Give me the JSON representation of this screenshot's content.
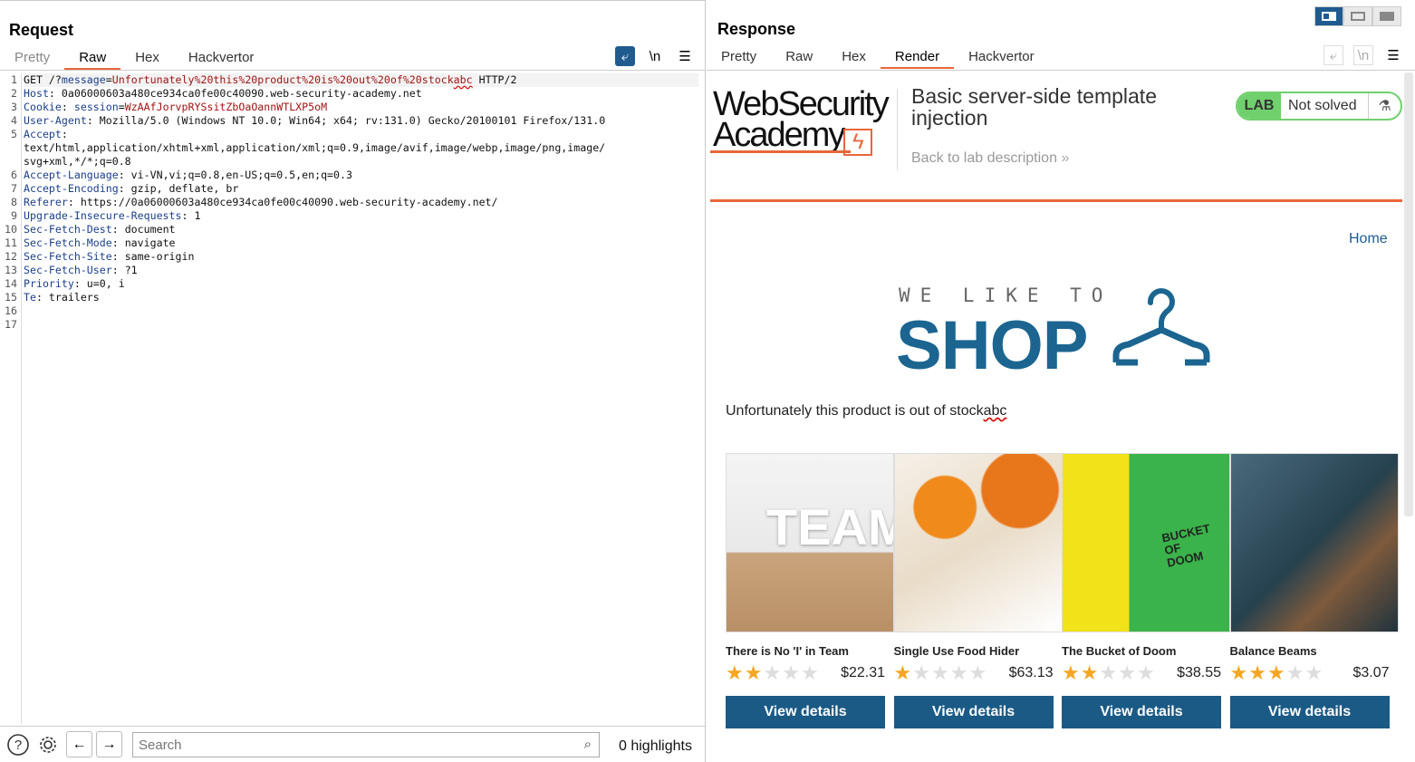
{
  "request": {
    "title": "Request",
    "tabs": [
      "Pretty",
      "Raw",
      "Hex",
      "Hackvertor"
    ],
    "toolbar": {
      "newline_label": "\\n"
    },
    "lines": [
      {
        "n": "1",
        "parts": [
          {
            "t": "GET /?"
          },
          {
            "t": "message",
            "c": "k"
          },
          {
            "t": "="
          },
          {
            "t": "Unfortunately%20this%20product%20is%20out%20of%20stock",
            "c": "v"
          },
          {
            "t": "abc",
            "c": "v sq"
          },
          {
            "t": " HTTP/2"
          }
        ],
        "hl": true
      },
      {
        "n": "2",
        "parts": [
          {
            "t": "Host",
            "c": "k"
          },
          {
            "t": ": 0a06000603a480ce934ca0fe00c40090.web-security-academy.net"
          }
        ]
      },
      {
        "n": "3",
        "parts": [
          {
            "t": "Cookie",
            "c": "k"
          },
          {
            "t": ": "
          },
          {
            "t": "session",
            "c": "k"
          },
          {
            "t": "="
          },
          {
            "t": "WzAAfJorvpRYSsitZbOaOannWTLXP5oM",
            "c": "v"
          }
        ]
      },
      {
        "n": "4",
        "parts": [
          {
            "t": "User-Agent",
            "c": "k"
          },
          {
            "t": ": Mozilla/5.0 (Windows NT 10.0; Win64; x64; rv:131.0) Gecko/20100101 Firefox/131.0"
          }
        ]
      },
      {
        "n": "5",
        "parts": [
          {
            "t": "Accept",
            "c": "k"
          },
          {
            "t": ":"
          }
        ]
      },
      {
        "n": "",
        "parts": [
          {
            "t": "text/html,application/xhtml+xml,application/xml;q=0.9,image/avif,image/webp,image/png,image/"
          }
        ]
      },
      {
        "n": "",
        "parts": [
          {
            "t": "svg+xml,*/*;q=0.8"
          }
        ]
      },
      {
        "n": "6",
        "parts": [
          {
            "t": "Accept-Language",
            "c": "k"
          },
          {
            "t": ": vi-VN,vi;q=0.8,en-US;q=0.5,en;q=0.3"
          }
        ]
      },
      {
        "n": "7",
        "parts": [
          {
            "t": "Accept-Encoding",
            "c": "k"
          },
          {
            "t": ": gzip, deflate, br"
          }
        ]
      },
      {
        "n": "8",
        "parts": [
          {
            "t": "Referer",
            "c": "k"
          },
          {
            "t": ": https://0a06000603a480ce934ca0fe00c40090.web-security-academy.net/"
          }
        ]
      },
      {
        "n": "9",
        "parts": [
          {
            "t": "Upgrade-Insecure-Requests",
            "c": "k"
          },
          {
            "t": ": 1"
          }
        ]
      },
      {
        "n": "10",
        "parts": [
          {
            "t": "Sec-Fetch-Dest",
            "c": "k"
          },
          {
            "t": ": document"
          }
        ]
      },
      {
        "n": "11",
        "parts": [
          {
            "t": "Sec-Fetch-Mode",
            "c": "k"
          },
          {
            "t": ": navigate"
          }
        ]
      },
      {
        "n": "12",
        "parts": [
          {
            "t": "Sec-Fetch-Site",
            "c": "k"
          },
          {
            "t": ": same-origin"
          }
        ]
      },
      {
        "n": "13",
        "parts": [
          {
            "t": "Sec-Fetch-User",
            "c": "k"
          },
          {
            "t": ": ?1"
          }
        ]
      },
      {
        "n": "14",
        "parts": [
          {
            "t": "Priority",
            "c": "k"
          },
          {
            "t": ": u=0, i"
          }
        ]
      },
      {
        "n": "15",
        "parts": [
          {
            "t": "Te",
            "c": "k"
          },
          {
            "t": ": trailers"
          }
        ]
      },
      {
        "n": "16",
        "parts": []
      },
      {
        "n": "17",
        "parts": []
      }
    ],
    "search": {
      "placeholder": "Search",
      "highlights": "0 highlights"
    }
  },
  "response": {
    "title": "Response",
    "tabs": [
      "Pretty",
      "Raw",
      "Hex",
      "Render",
      "Hackvertor"
    ],
    "render": {
      "logo_line1": "WebSecurity",
      "logo_line2": "Academy",
      "lab_title": "Basic server-side template injection",
      "back_link": "Back to lab description",
      "lab_label": "LAB",
      "lab_status": "Not solved",
      "home_link": "Home",
      "shop_tagline": "WE LIKE TO",
      "shop_name": "SHOP",
      "message_text": "Unfortunately this product is out of stock",
      "message_suffix": "abc",
      "products": [
        {
          "name": "There is No 'I' in Team",
          "price": "$22.31",
          "rating": 2,
          "button": "View details",
          "img_text": "TEAM"
        },
        {
          "name": "Single Use Food Hider",
          "price": "$63.13",
          "rating": 1,
          "button": "View details",
          "img_text": ""
        },
        {
          "name": "The Bucket of Doom",
          "price": "$38.55",
          "rating": 2,
          "button": "View details",
          "img_text": "BUCKET OF DOOM"
        },
        {
          "name": "Balance Beams",
          "price": "$3.07",
          "rating": 3,
          "button": "View details",
          "img_text": ""
        }
      ]
    }
  },
  "colors": {
    "accent_orange": "#e8673a",
    "brand_blue": "#1b5a85",
    "lab_green": "#70d06d",
    "star": "#f5a623"
  }
}
